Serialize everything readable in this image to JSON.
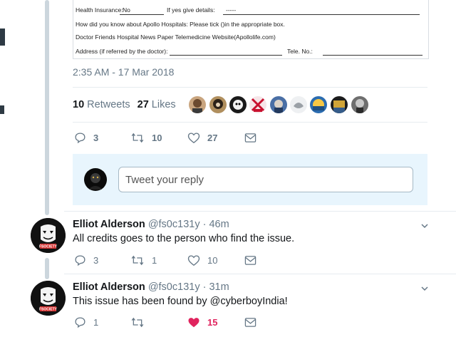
{
  "document": {
    "health_label": "Health Insurance:",
    "health_value": "No",
    "give_details_label": "If yes give details:",
    "give_details_value": "-----",
    "question": "How did you know about Apollo Hospitals: Please tick ()in the appropriate box.",
    "options": "Doctor Friends Hospital News Paper Telemedicine Website(Apollolife.com)",
    "address_label": "Address (if referred by the doctor):",
    "tele_label": "Tele. No.:"
  },
  "main_tweet": {
    "timestamp": "2:35 AM - 17 Mar 2018",
    "retweets_count": "10",
    "retweets_label": "Retweets",
    "likes_count": "27",
    "likes_label": "Likes",
    "replies": "3",
    "retweets": "10",
    "likes": "27"
  },
  "reply_composer": {
    "placeholder": "Tweet your reply"
  },
  "replies": [
    {
      "name": "Elliot Alderson",
      "handle": "@fs0c131y",
      "time": "· 46m",
      "text": "All credits goes to the person who find the issue.",
      "replies": "3",
      "retweets": "1",
      "likes": "10",
      "avatar_label": "FSOCIETY"
    },
    {
      "name": "Elliot Alderson",
      "handle": "@fs0c131y",
      "time": "· 31m",
      "text": "This issue has been found by @cyberboyIndia!",
      "replies": "1",
      "retweets": "",
      "likes": "15",
      "avatar_label": "FSOCIETY"
    }
  ],
  "colors": {
    "muted": "#657786",
    "text": "#14171a",
    "like_active": "#e0245e",
    "reply_area_bg": "#e8f5fd",
    "thread_line": "#ccd6dd"
  }
}
